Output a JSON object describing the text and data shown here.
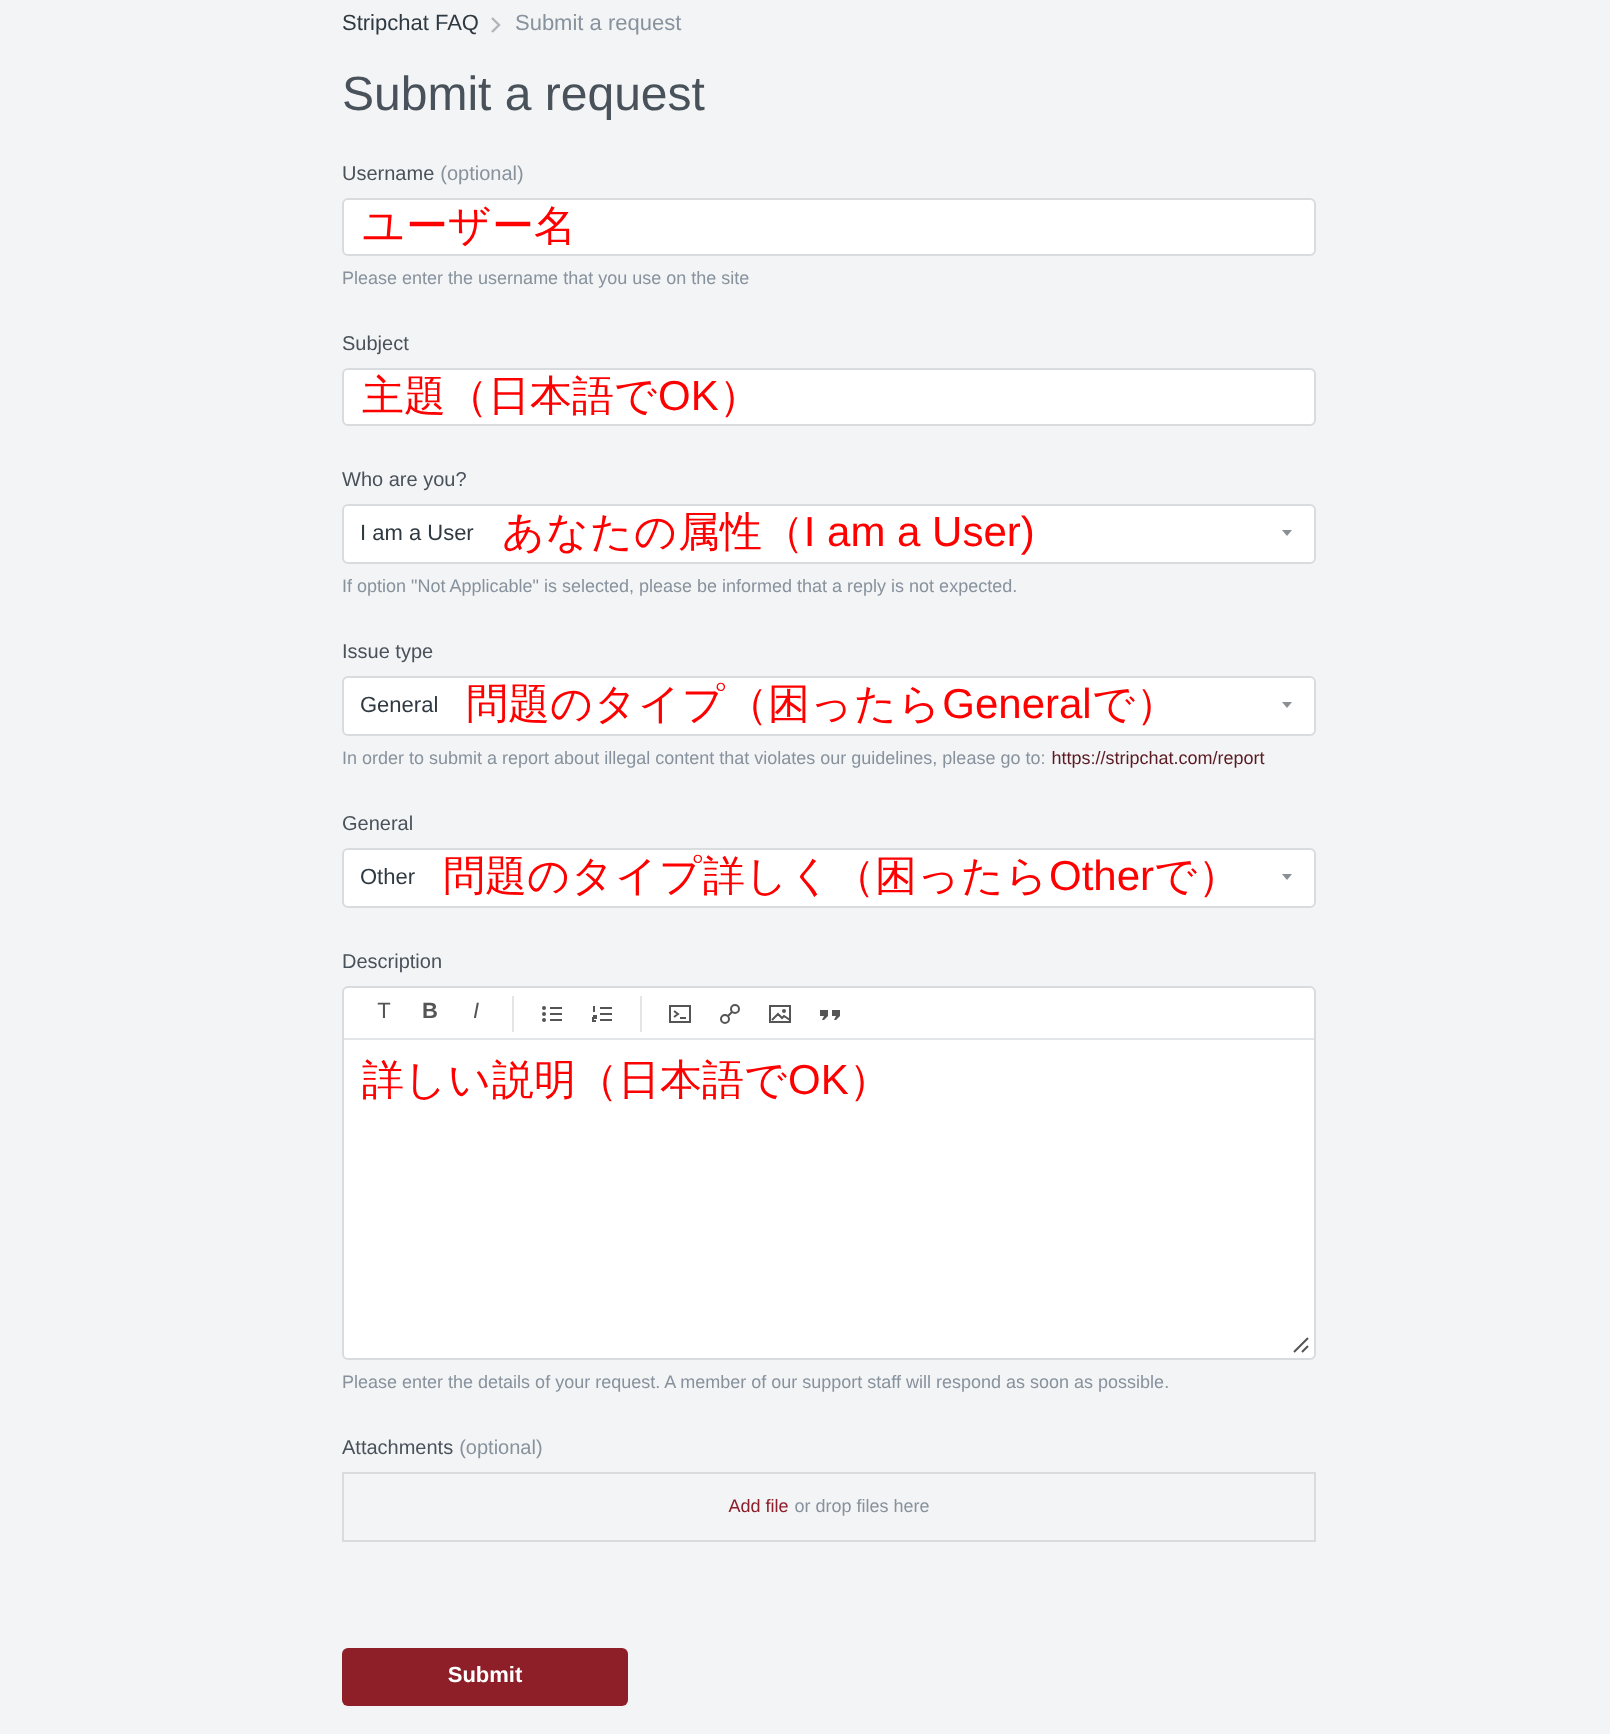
{
  "breadcrumb": [
    "Stripchat FAQ",
    "Submit a request"
  ],
  "title": "Submit a request",
  "fields": [
    {
      "kind": "text",
      "label": "Username",
      "optional": "(optional)",
      "annotation": "ユーザー名",
      "hint": "Please enter the username that you use on the site"
    },
    {
      "kind": "text",
      "label": "Subject",
      "annotation": "主題（日本語でOK）"
    },
    {
      "kind": "select",
      "label": "Who are you?",
      "value": "I am a User",
      "annotation": "あなたの属性（I am a User)",
      "hint": "If option \"Not Applicable\" is selected, please be informed that a reply is not expected."
    },
    {
      "kind": "select",
      "label": "Issue type",
      "value": "General",
      "annotation": "問題のタイプ（困ったらGeneralで）",
      "hint": "In order to submit a report about illegal content that violates our guidelines, please go to:",
      "hint_link": "https://stripchat.com/report"
    },
    {
      "kind": "select",
      "label": "General",
      "value": "Other",
      "annotation": "問題のタイプ詳しく（困ったらOtherで）"
    },
    {
      "kind": "editor",
      "label": "Description",
      "toolbar": [
        "T",
        "B",
        "I"
      ],
      "annotation": "詳しい説明（日本語でOK）",
      "hint": "Please enter the details of your request. A member of our support staff will respond as soon as possible."
    },
    {
      "kind": "attachments",
      "label": "Attachments",
      "optional": "(optional)",
      "link": "Add file",
      "text": "or drop files here"
    }
  ],
  "submit": "Submit"
}
